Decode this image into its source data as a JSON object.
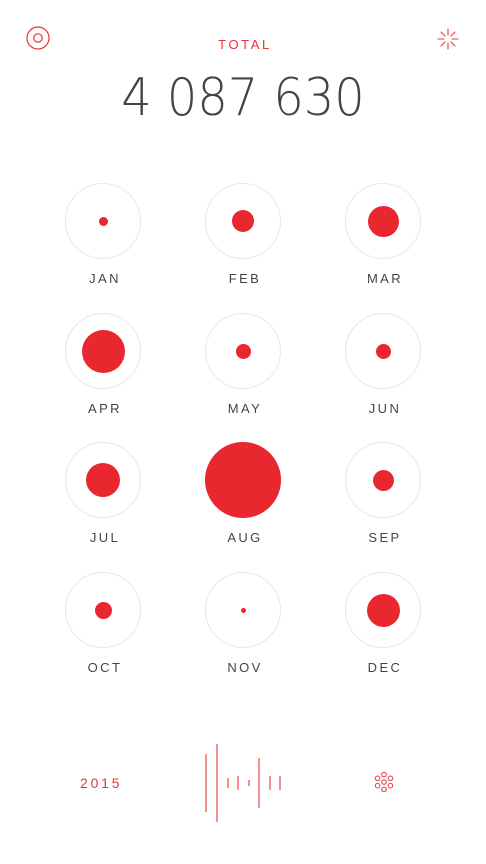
{
  "header": {
    "total_label": "TOTAL",
    "total_value": "4 087 630",
    "left_icon": "target-icon",
    "right_icon": "sparkle-icon"
  },
  "accent_color": "#e8272e",
  "months": [
    {
      "label": "JAN",
      "level": 0.12
    },
    {
      "label": "FEB",
      "level": 0.29
    },
    {
      "label": "MAR",
      "level": 0.41
    },
    {
      "label": "APR",
      "level": 0.57
    },
    {
      "label": "MAY",
      "level": 0.2
    },
    {
      "label": "JUN",
      "level": 0.2
    },
    {
      "label": "JUL",
      "level": 0.45
    },
    {
      "label": "AUG",
      "level": 1.0
    },
    {
      "label": "SEP",
      "level": 0.27
    },
    {
      "label": "OCT",
      "level": 0.23
    },
    {
      "label": "NOV",
      "level": 0.06
    },
    {
      "label": "DEC",
      "level": 0.43
    }
  ],
  "footer": {
    "year": "2015",
    "timeline_icon": "timeline-bars-icon",
    "settings_icon": "flower-icon"
  }
}
